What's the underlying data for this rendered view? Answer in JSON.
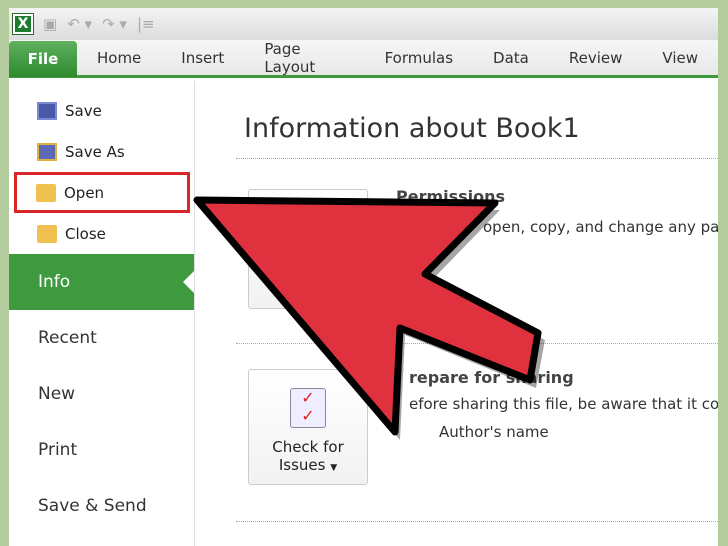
{
  "qat": {
    "app_icon": "excel-icon",
    "items": [
      "save-icon",
      "undo-icon",
      "redo-icon",
      "customize-icon"
    ]
  },
  "ribbon": {
    "tabs": [
      "File",
      "Home",
      "Insert",
      "Page Layout",
      "Formulas",
      "Data",
      "Review",
      "View"
    ]
  },
  "sidebar": {
    "commands": [
      {
        "label": "Save",
        "icon": "save-icon"
      },
      {
        "label": "Save As",
        "icon": "save-as-icon"
      },
      {
        "label": "Open",
        "icon": "open-folder-icon"
      },
      {
        "label": "Close",
        "icon": "close-folder-icon"
      }
    ],
    "sections": [
      "Info",
      "Recent",
      "New",
      "Print",
      "Save & Send"
    ],
    "selected": "Info"
  },
  "main": {
    "title": "Information about Book1",
    "permissions": {
      "heading": "Permissions",
      "desc": "open, copy, and change any pa"
    },
    "prepare": {
      "heading": "repare for sharing",
      "desc": "efore sharing this file, be aware that it con",
      "item": "Author's name",
      "button_line1": "Check for",
      "button_line2": "Issues"
    }
  },
  "colors": {
    "accent": "#3f9a3f",
    "highlight": "#d9262b",
    "arrow": "#e0313f"
  }
}
